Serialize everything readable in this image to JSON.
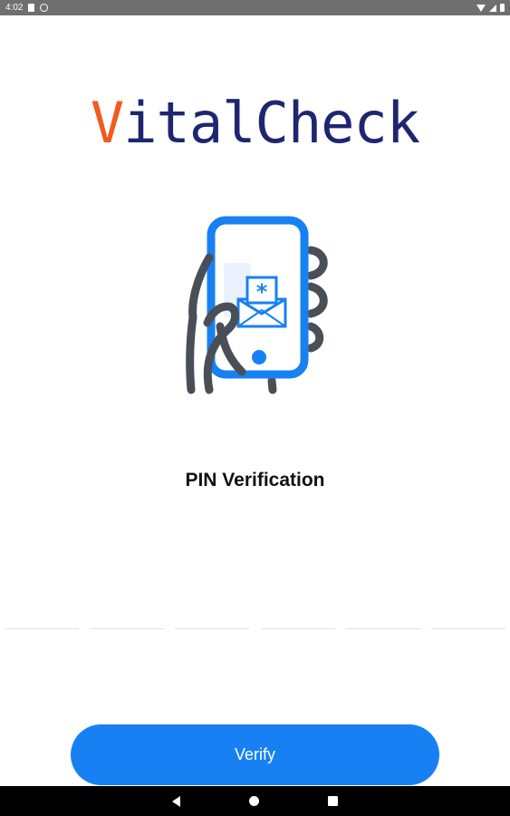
{
  "status_bar": {
    "time": "4:02",
    "icons": [
      "sim-card-icon",
      "data-saver-icon",
      "wifi-icon",
      "signal-icon",
      "battery-icon"
    ]
  },
  "logo": {
    "first_letter": "V",
    "rest": "italCheck",
    "colors": {
      "accent": "#f25a1f",
      "brand": "#1f2670"
    }
  },
  "illustration": {
    "icon": "phone-pin-message-icon",
    "accent": "#1781f3"
  },
  "page": {
    "title": "PIN Verification"
  },
  "pin": {
    "length": 6,
    "digits": [
      "",
      "",
      "",
      "",
      "",
      ""
    ]
  },
  "verify_button": {
    "label": "Verify",
    "color": "#1781f3"
  },
  "nav_bar": {
    "icons": [
      "back-icon",
      "home-icon",
      "recents-icon"
    ]
  }
}
